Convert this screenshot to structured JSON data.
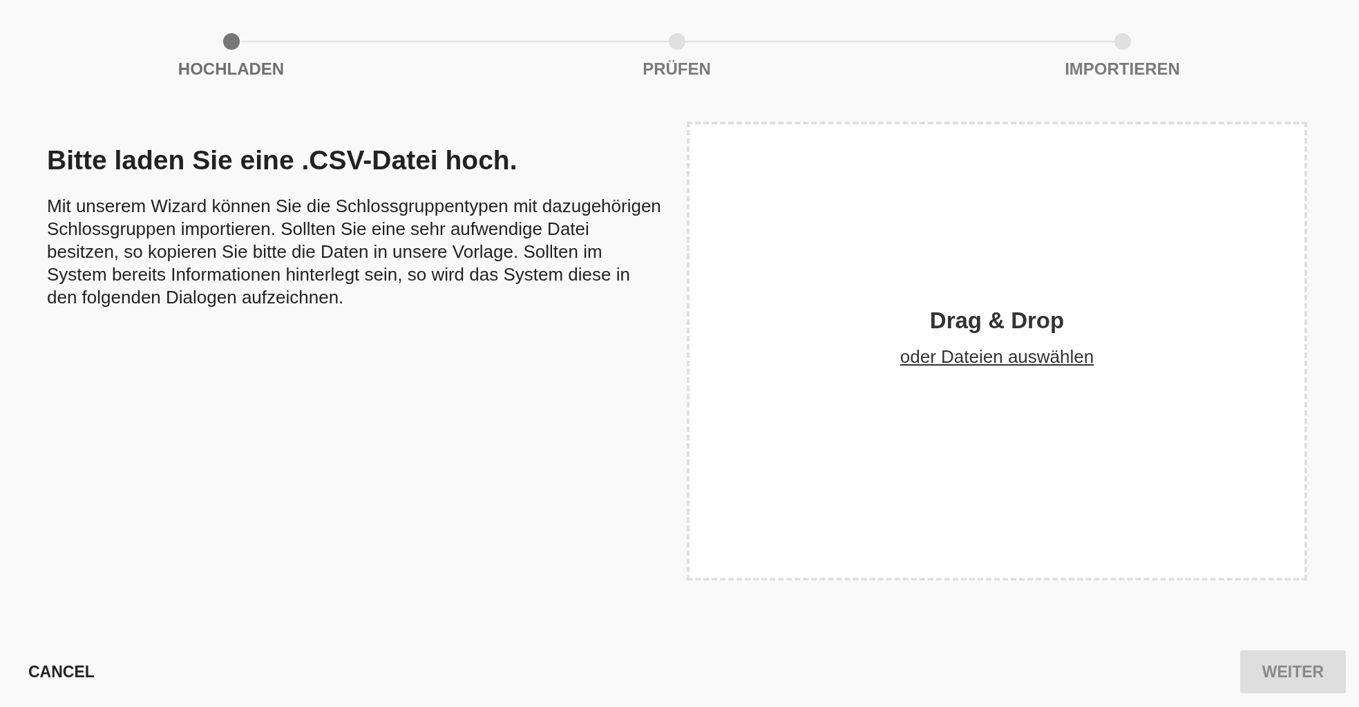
{
  "steps": [
    {
      "label": "HOCHLADEN",
      "selected": true
    },
    {
      "label": "PRÜFEN",
      "selected": false
    },
    {
      "label": "IMPORTIEREN",
      "selected": false
    }
  ],
  "intro": {
    "title": "Bitte laden Sie eine .CSV-Datei hoch.",
    "text": "Mit unserem Wizard können Sie die Schlossgruppentypen mit dazugehörigen Schlossgruppen importieren. Sollten Sie eine sehr aufwendige Datei besitzen, so kopieren Sie bitte die Daten in unsere Vorlage. Sollten im System bereits Informationen hinterlegt sein, so wird das System diese in den folgenden Dialogen aufzeichnen."
  },
  "dropzone": {
    "title": "Drag & Drop",
    "link": "oder Dateien auswählen"
  },
  "footer": {
    "cancel": "CANCEL",
    "next": {
      "label": "WEITER",
      "disabled": true
    }
  }
}
